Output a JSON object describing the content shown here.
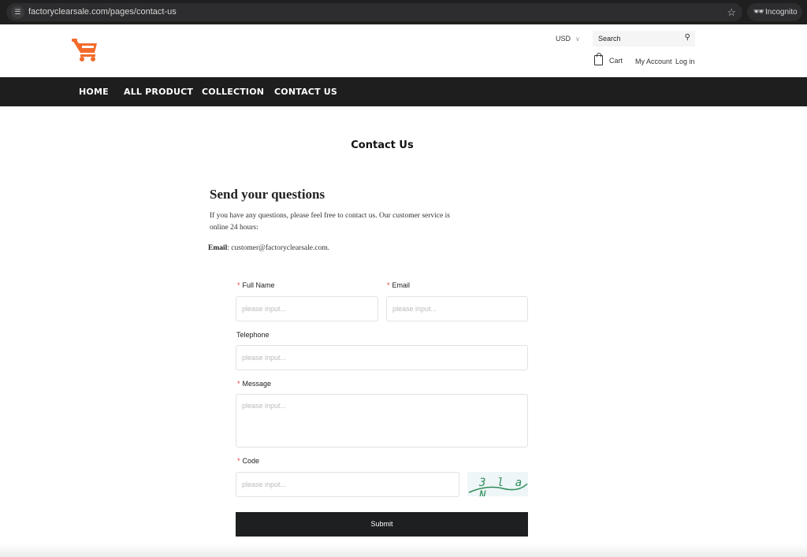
{
  "browser": {
    "url": "factoryclearsale.com/pages/contact-us",
    "incognito_label": "Incognito"
  },
  "header": {
    "currency": "USD",
    "search_placeholder": "Search",
    "cart_label": "Cart",
    "account_label": "My Account",
    "login_label": "Log in",
    "logo_color": "#f26b2a"
  },
  "nav": {
    "items": [
      {
        "label": "HOME"
      },
      {
        "label": "ALL PRODUCT"
      },
      {
        "label": "COLLECTION"
      },
      {
        "label": "CONTACT US"
      }
    ]
  },
  "page": {
    "title": "Contact Us",
    "section_title": "Send your questions",
    "intro": "If you have any questions, please feel free to contact us. Our customer service is online 24 hours:",
    "email_label": "Email",
    "email_value": ": customer@factoryclearsale.com."
  },
  "form": {
    "required_mark": "*",
    "full_name": {
      "label": "Full Name",
      "placeholder": "please input...",
      "value": ""
    },
    "email": {
      "label": "Email",
      "placeholder": "please input...",
      "value": ""
    },
    "telephone": {
      "label": "Telephone",
      "placeholder": "please input...",
      "value": ""
    },
    "message": {
      "label": "Message",
      "placeholder": "please input...",
      "value": ""
    },
    "code": {
      "label": "Code",
      "placeholder": "please input...",
      "value": ""
    },
    "captcha_text": "3 l a N",
    "submit_label": "Submit"
  }
}
